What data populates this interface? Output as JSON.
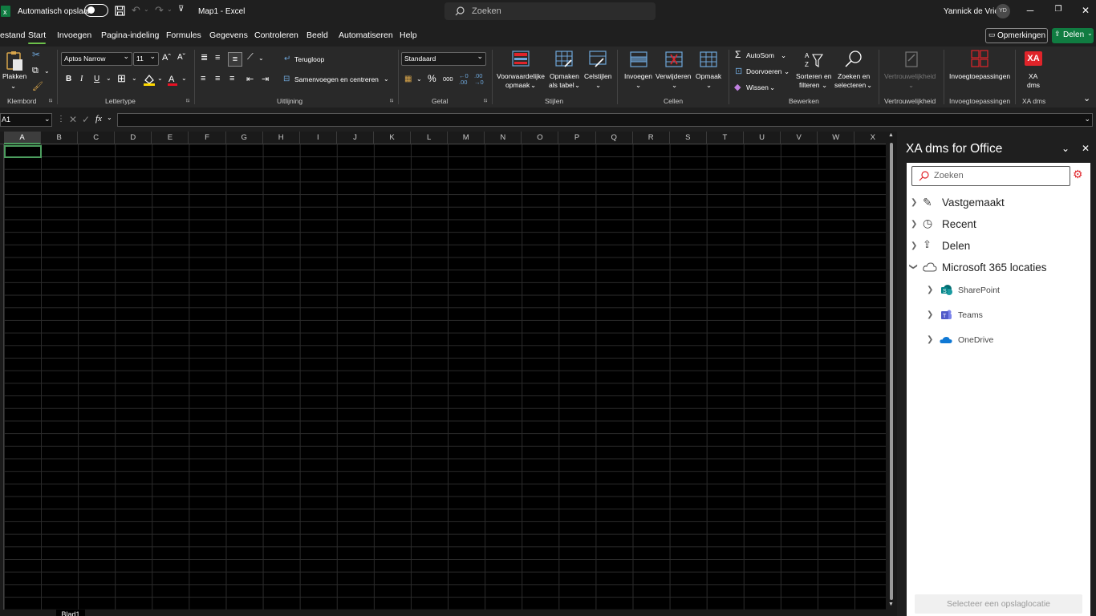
{
  "titlebar": {
    "autosave_label": "Automatisch opslaan",
    "doc_title": "Map1 - Excel",
    "search_placeholder": "Zoeken",
    "user_name": "Yannick de Vries",
    "user_initials": "YD"
  },
  "tabs": [
    "estand",
    "Start",
    "Invoegen",
    "Pagina-indeling",
    "Formules",
    "Gegevens",
    "Controleren",
    "Beeld",
    "Automatiseren",
    "Help"
  ],
  "active_tab": "Start",
  "tabbar_buttons": {
    "comments": "Opmerkingen",
    "share": "Delen"
  },
  "ribbon": {
    "clipboard": {
      "paste": "Plakken",
      "group": "Klembord"
    },
    "font": {
      "name": "Aptos Narrow",
      "size": "11",
      "group": "Lettertype"
    },
    "alignment": {
      "wrap": "Terugloop",
      "merge": "Samenvoegen en centreren",
      "group": "Uitlijning"
    },
    "number": {
      "format": "Standaard",
      "group": "Getal"
    },
    "styles": {
      "conditional_1": "Voorwaardelijke",
      "conditional_2": "opmaak",
      "table_1": "Opmaken",
      "table_2": "als tabel",
      "cell": "Celstijlen",
      "group": "Stijlen"
    },
    "cells": {
      "insert": "Invoegen",
      "delete": "Verwijderen",
      "format": "Opmaak",
      "group": "Cellen"
    },
    "editing": {
      "autosum": "AutoSom",
      "fill": "Doorvoeren",
      "clear": "Wissen",
      "sort_1": "Sorteren en",
      "sort_2": "filteren",
      "find_1": "Zoeken en",
      "find_2": "selecteren",
      "group": "Bewerken"
    },
    "sensitivity": {
      "label": "Vertrouwelijkheid",
      "group": "Vertrouwelijkheid"
    },
    "addins": {
      "label": "Invoegtoepassingen",
      "group": "Invoegtoepassingen"
    },
    "xadms": {
      "logo": "XA",
      "label_1": "XA",
      "label_2": "dms",
      "group": "XA dms"
    }
  },
  "formula_bar": {
    "name_box": "A1",
    "fx": "fx",
    "value": ""
  },
  "columns": [
    "A",
    "B",
    "C",
    "D",
    "E",
    "F",
    "G",
    "H",
    "I",
    "J",
    "K",
    "L",
    "M",
    "N",
    "O",
    "P",
    "Q",
    "R",
    "S",
    "T",
    "U",
    "V",
    "W",
    "X"
  ],
  "sheet_tab": "Blad1",
  "panel": {
    "title": "XA dms for Office",
    "search_placeholder": "Zoeken",
    "items": [
      {
        "label": "Vastgemaakt",
        "icon": "pin-icon"
      },
      {
        "label": "Recent",
        "icon": "clock-icon"
      },
      {
        "label": "Delen",
        "icon": "share-icon"
      },
      {
        "label": "Microsoft 365 locaties",
        "icon": "cloud-icon"
      }
    ],
    "subitems": [
      {
        "label": "SharePoint",
        "icon": "sharepoint-icon"
      },
      {
        "label": "Teams",
        "icon": "teams-icon"
      },
      {
        "label": "OneDrive",
        "icon": "onedrive-icon"
      }
    ],
    "select_button": "Selecteer een opslaglocatie"
  },
  "colors": {
    "accent_green": "#107c41",
    "selection": "#4c9d5e",
    "xa_red": "#e0242a"
  }
}
